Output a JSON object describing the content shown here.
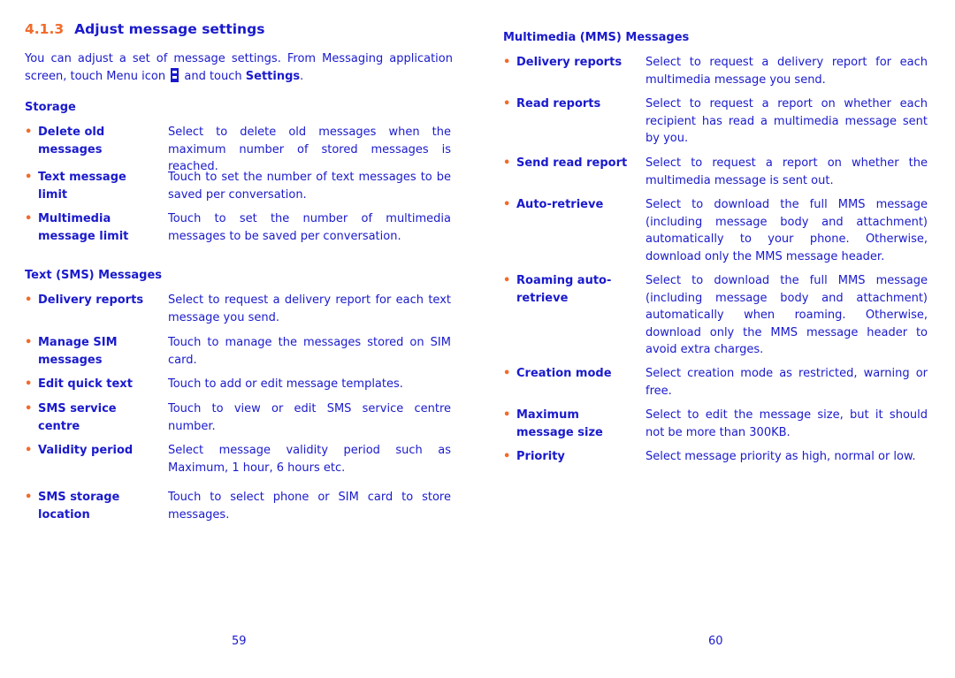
{
  "left_page": {
    "section_number": "4.1.3",
    "section_title": "Adjust message settings",
    "intro_part1": "You can adjust a set of message settings. From Messaging application screen, touch Menu icon",
    "intro_part2": "and touch",
    "intro_bold": "Settings",
    "intro_end": ".",
    "storage": {
      "title": "Storage",
      "items": [
        {
          "term_l1": "Delete old",
          "term_l2": "messages",
          "desc": "Select to delete old messages when the maximum number of stored messages is reached."
        },
        {
          "term_l1": "Text message",
          "term_l2": "limit",
          "desc": "Touch to set the number of text messages to be saved per conversation."
        },
        {
          "term_l1": "Multimedia",
          "term_l2": "message limit",
          "desc": "Touch to set the number of multimedia messages to be saved per conversation."
        }
      ]
    },
    "sms": {
      "title": "Text (SMS) Messages",
      "items": [
        {
          "term_l1": "Delivery reports",
          "term_l2": "",
          "desc": "Select to request a delivery report for each text message you send."
        },
        {
          "term_l1": "Manage SIM",
          "term_l2": "messages",
          "desc": "Touch to manage the messages stored on SIM card."
        },
        {
          "term_l1": "Edit quick text",
          "term_l2": "",
          "desc": "Touch to add or edit message templates."
        },
        {
          "term_l1": "SMS service",
          "term_l2": "centre",
          "desc": "Touch to view or edit SMS service centre number."
        },
        {
          "term_l1": "Validity period",
          "term_l2": "",
          "desc": "Select message validity period such as Maximum, 1 hour, 6 hours etc."
        },
        {
          "term_l1": "SMS storage",
          "term_l2": "location",
          "desc": "Touch to select phone or SIM card to store messages."
        }
      ]
    },
    "page_number": "59"
  },
  "right_page": {
    "mms": {
      "title": "Multimedia (MMS) Messages",
      "items": [
        {
          "term_l1": "Delivery reports",
          "term_l2": "",
          "desc": "Select to request a delivery report for each multimedia message you send."
        },
        {
          "term_l1": "Read reports",
          "term_l2": "",
          "desc": "Select to request a report on whether each recipient has read a multimedia message sent by you."
        },
        {
          "term_l1": "Send read report",
          "term_l2": "",
          "desc": "Select to request a report on whether the multimedia message is sent out."
        },
        {
          "term_l1": "Auto-retrieve",
          "term_l2": "",
          "desc": "Select to download the full MMS message (including message body and attachment) automatically to your phone. Otherwise, download only the MMS message header."
        },
        {
          "term_l1": "Roaming auto-",
          "term_l2": "retrieve",
          "desc": "Select to download the full MMS message (including message body and attachment) automatically when roaming. Otherwise, download only the MMS message header to avoid extra charges."
        },
        {
          "term_l1": "Creation mode",
          "term_l2": "",
          "desc": "Select creation mode as restricted, warning or free."
        },
        {
          "term_l1": "Maximum",
          "term_l2": "message size",
          "desc": "Select to edit the message size, but it should not be more than 300KB."
        },
        {
          "term_l1": "Priority",
          "term_l2": "",
          "desc": "Select message priority as high, normal or low."
        }
      ]
    },
    "page_number": "60"
  },
  "colors": {
    "text": "#1a1acc",
    "accent": "#f26b2a"
  }
}
